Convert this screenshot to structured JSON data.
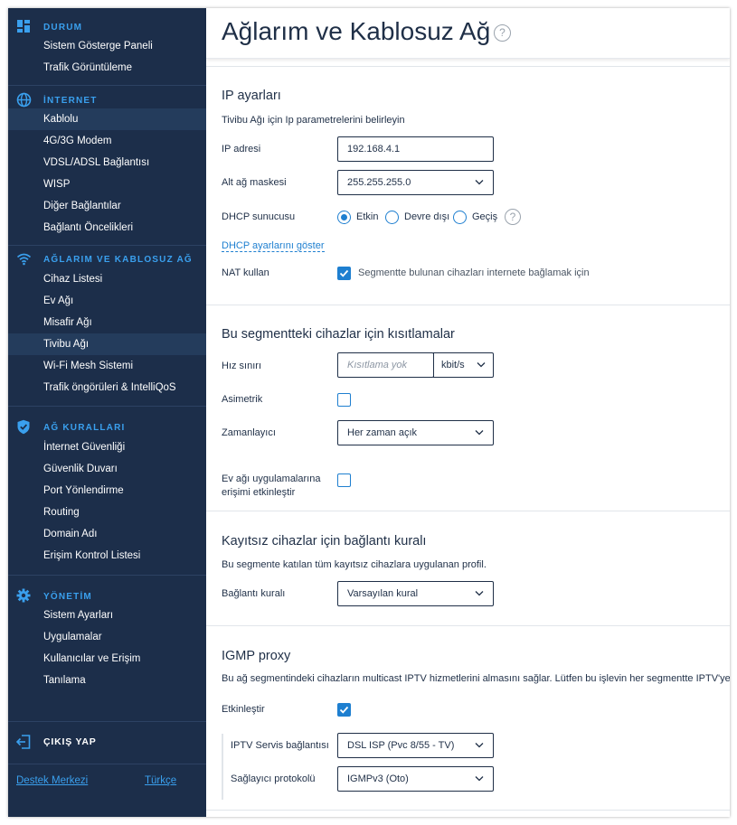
{
  "sidebar": {
    "sections": [
      {
        "title": "DURUM",
        "icon": "dashboard-icon",
        "items": [
          "Sistem Gösterge Paneli",
          "Trafik Görüntüleme"
        ]
      },
      {
        "title": "İNTERNET",
        "icon": "globe-icon",
        "items": [
          "Kablolu",
          "4G/3G Modem",
          "VDSL/ADSL Bağlantısı",
          "WISP",
          "Diğer Bağlantılar",
          "Bağlantı Öncelikleri"
        ]
      },
      {
        "title": "AĞLARIM VE KABLOSUZ AĞ",
        "icon": "wifi-icon",
        "items": [
          "Cihaz Listesi",
          "Ev Ağı",
          "Misafir Ağı",
          "Tivibu Ağı",
          "Wi-Fi Mesh Sistemi",
          "Trafik öngörüleri & IntelliQoS"
        ]
      },
      {
        "title": "AĞ KURALLARI",
        "icon": "shield-icon",
        "items": [
          "İnternet Güvenliği",
          "Güvenlik Duvarı",
          "Port Yönlendirme",
          "Routing",
          "Domain Adı",
          "Erişim Kontrol Listesi"
        ]
      },
      {
        "title": "YÖNETİM",
        "icon": "gear-icon",
        "items": [
          "Sistem Ayarları",
          "Uygulamalar",
          "Kullanıcılar ve Erişim",
          "Tanılama"
        ]
      }
    ],
    "logout_label": "ÇIKIŞ YAP",
    "help_center": "Destek Merkezi",
    "language": "Türkçe"
  },
  "page": {
    "title": "Ağlarım ve Kablosuz Ağ",
    "help_glyph": "?"
  },
  "ip": {
    "title": "IP ayarları",
    "desc": "Tivibu Ağı için Ip parametrelerini belirleyin",
    "address_label": "IP adresi",
    "address_value": "192.168.4.1",
    "mask_label": "Alt ağ maskesi",
    "mask_value": "255.255.255.0",
    "dhcp_label": "DHCP sunucusu",
    "dhcp_options": [
      "Etkin",
      "Devre dışı",
      "Geçiş"
    ],
    "dhcp_selected": "Etkin",
    "dhcp_link": "DHCP ayarlarını göster",
    "nat_label": "NAT kullan",
    "nat_text": "Segmentte bulunan cihazları internete bağlamak için",
    "nat_checked": true
  },
  "restrictions": {
    "title": "Bu segmentteki cihazlar için kısıtlamalar",
    "speed_label": "Hız sınırı",
    "speed_placeholder": "Kısıtlama yok",
    "speed_unit": "kbit/s",
    "asym_label": "Asimetrik",
    "asym_checked": false,
    "scheduler_label": "Zamanlayıcı",
    "scheduler_value": "Her zaman açık",
    "homeapps_label_1": "Ev ağı uygulamalarına",
    "homeapps_label_2": "erişimi etkinleştir",
    "homeapps_checked": false
  },
  "unregistered": {
    "title": "Kayıtsız cihazlar için bağlantı kuralı",
    "desc": "Bu segmente katılan tüm kayıtsız cihazlara uygulanan profil.",
    "rule_label": "Bağlantı kuralı",
    "rule_value": "Varsayılan kural"
  },
  "igmp": {
    "title": "IGMP proxy",
    "desc": "Bu ağ segmentindeki cihazların multicast IPTV hizmetlerini almasını sağlar. Lütfen bu işlevin her segmentte IPTV'ye hizm",
    "enable_label": "Etkinleştir",
    "enable_checked": true,
    "iptv_label": "IPTV Servis bağlantısı",
    "iptv_value": "DSL ISP (Pvc 8/55 - TV)",
    "protocol_label": "Sağlayıcı protokolü",
    "protocol_value": "IGMPv3 (Oto)"
  },
  "colors": {
    "sidebar_bg": "#1c2e4a",
    "accent": "#1e7fd0",
    "section_title": "#3aa0ee",
    "text": "#1f2f47"
  }
}
